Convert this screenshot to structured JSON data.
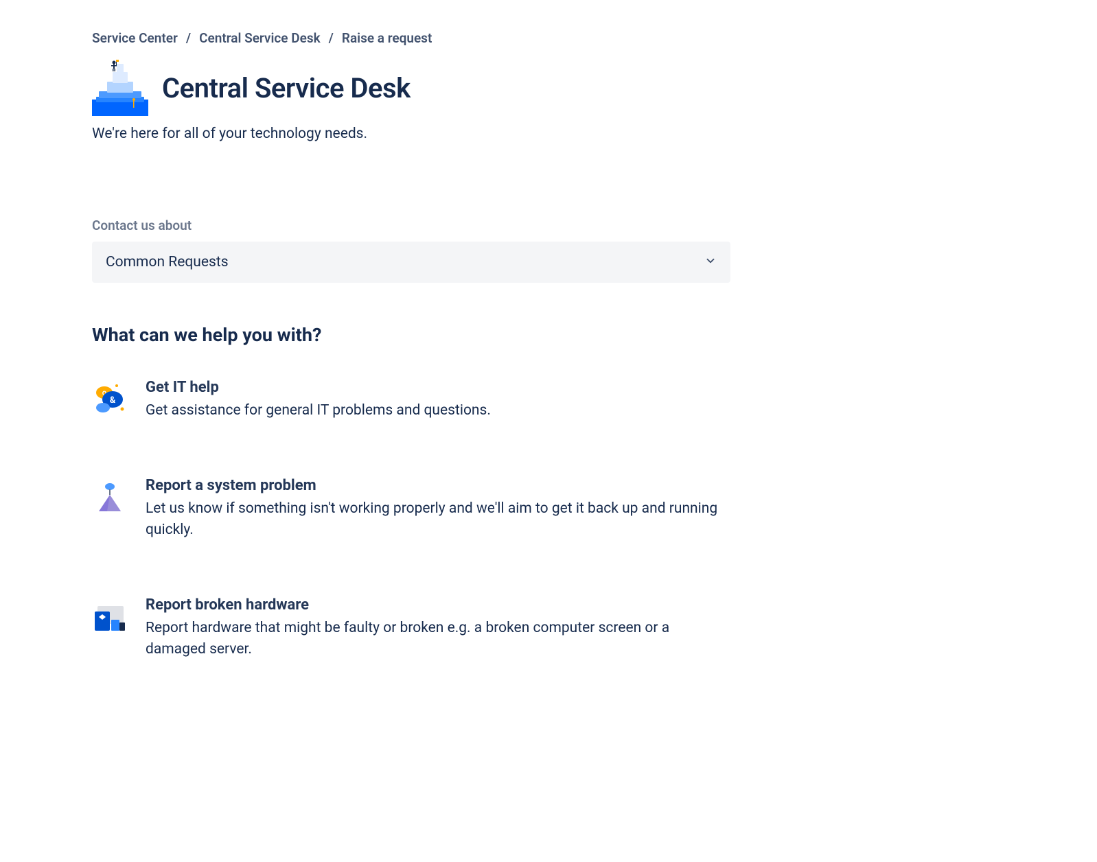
{
  "breadcrumb": {
    "items": [
      "Service Center",
      "Central Service Desk",
      "Raise a request"
    ]
  },
  "header": {
    "title": "Central Service Desk",
    "subtitle": "We're here for all of your technology needs."
  },
  "contact": {
    "label": "Contact us about",
    "selected": "Common Requests"
  },
  "help": {
    "heading": "What can we help you with?",
    "requests": [
      {
        "title": "Get IT help",
        "description": "Get assistance for general IT problems and questions."
      },
      {
        "title": "Report a system problem",
        "description": "Let us know if something isn't working properly and we'll aim to get it back up and running quickly."
      },
      {
        "title": "Report broken hardware",
        "description": "Report hardware that might be faulty or broken e.g. a broken computer screen or a damaged server."
      }
    ]
  }
}
